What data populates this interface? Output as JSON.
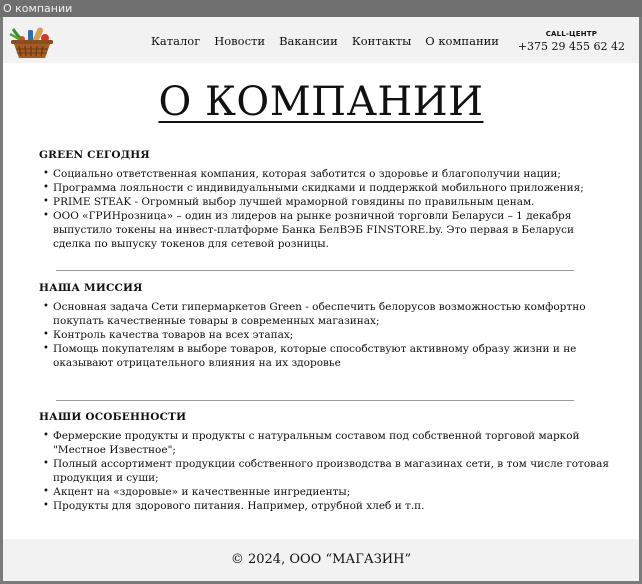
{
  "window": {
    "title": "О компании"
  },
  "header": {
    "nav": [
      "Каталог",
      "Новости",
      "Вакансии",
      "Контакты",
      "О компании"
    ],
    "call_center_label": "CALL-ЦЕНТР",
    "phone": "+375 29 455 62 42"
  },
  "page_title": "О КОМПАНИИ",
  "sections": [
    {
      "heading": "GREEN СЕГОДНЯ",
      "items": [
        "Социально ответственная компания, которая заботится о здоровье и благополучии нации;",
        "Программа лояльности с индивидуальными скидками и поддержкой мобильного приложения;",
        "PRIME STEAK - Огромный выбор лучшей мраморной говядины по правильным ценам.",
        "ООО «ГРИНрозница» – один из лидеров на рынке розничной торговли Беларуси – 1 декабря выпустило токены на инвест-платформе Банка БелВЭБ FINSTORE.by. Это первая в Беларуси сделка по выпуску токенов для сетевой розницы."
      ]
    },
    {
      "heading": "НАША МИССИЯ",
      "items": [
        "Основная задача Сети гипермаркетов Green - обеспечить белорусов возможностью комфортно покупать качественные товары в современных магазинах;",
        "Контроль качества товаров на всех этапах;",
        "Помощь покупателям в выборе товаров, которые способствуют активному образу жизни и не оказывают отрицательного влияния на их здоровье"
      ]
    },
    {
      "heading": "НАШИ ОСОБЕННОСТИ",
      "items": [
        "Фермерские продукты и продукты с натуральным составом под собственной торговой маркой \"Местное Известное\";",
        "Полный ассортимент продукции собственного производства в магазинах сети, в том числе готовая продукция и суши;",
        "Акцент на «здоровые» и качественные ингредиенты;",
        "Продукты для здорового питания. Например, отрубной хлеб и т.п."
      ]
    }
  ],
  "footer": {
    "text": "© 2024, ООО “МАГАЗИН”"
  }
}
